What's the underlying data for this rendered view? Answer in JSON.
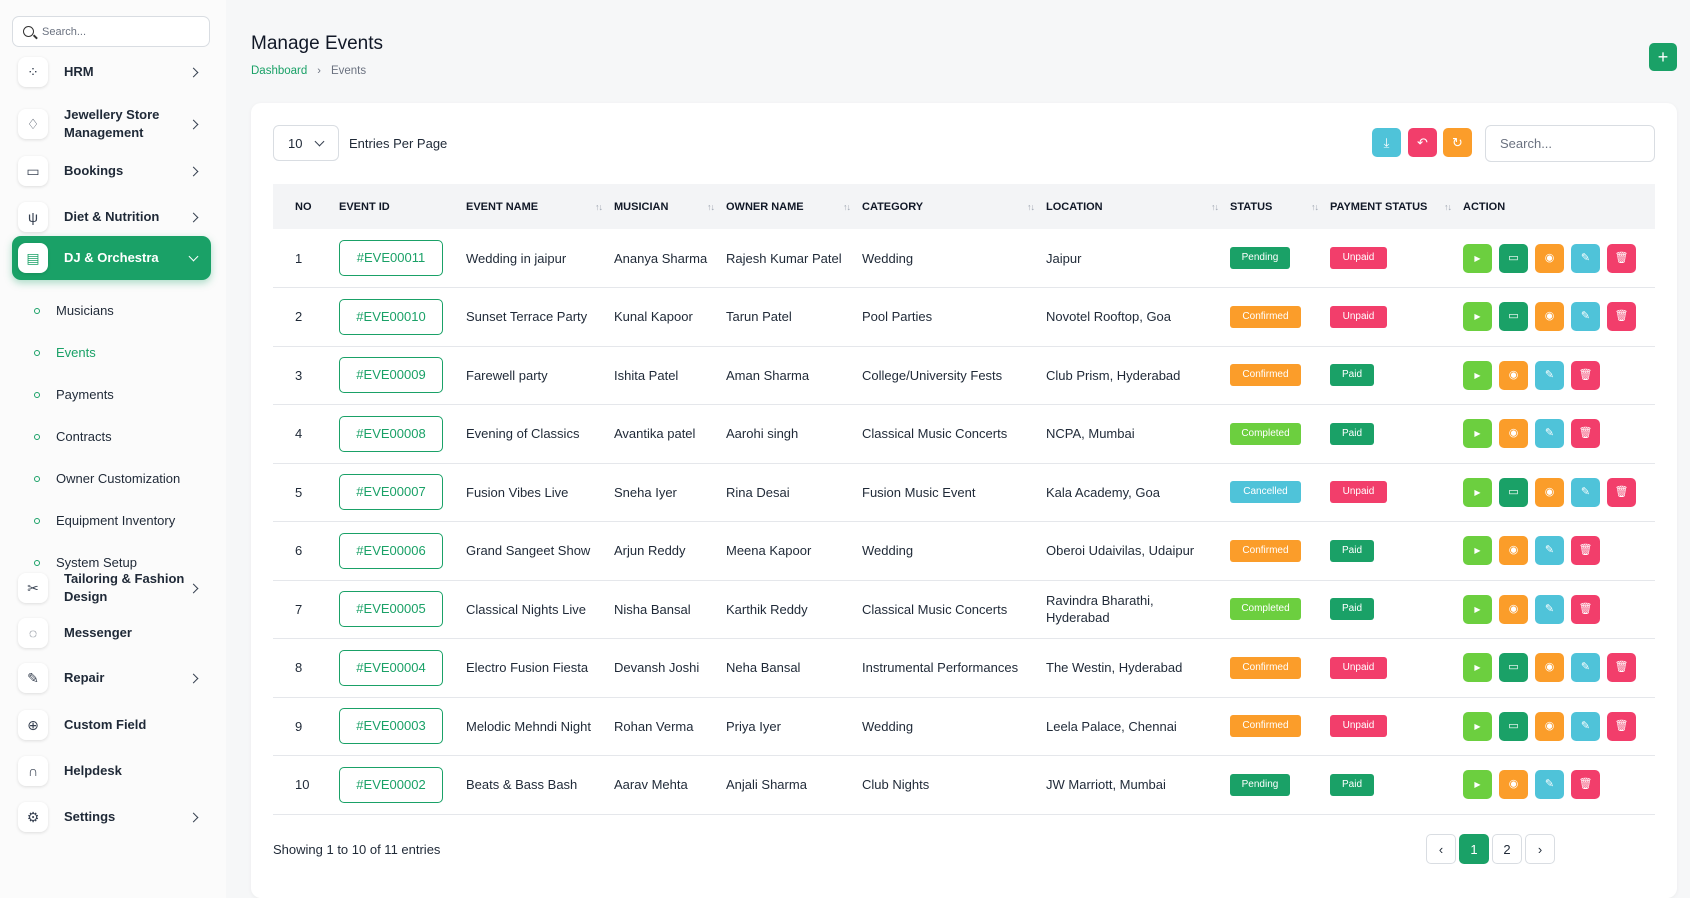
{
  "sidebar": {
    "search_placeholder": "Search...",
    "items": [
      {
        "label": "HRM",
        "icon": "hrm-icon",
        "glyph": "⁘"
      },
      {
        "label": "Jewellery Store Management",
        "icon": "diamond-icon",
        "glyph": "♢"
      },
      {
        "label": "Bookings",
        "icon": "book-icon",
        "glyph": "▭"
      },
      {
        "label": "Diet & Nutrition",
        "icon": "utensils-icon",
        "glyph": "ψ"
      },
      {
        "label": "DJ & Orchestra",
        "icon": "dj-icon",
        "glyph": "▤"
      },
      {
        "label": "Tailoring & Fashion Design",
        "icon": "scissors-icon",
        "glyph": "✂"
      },
      {
        "label": "Messenger",
        "icon": "chat-icon",
        "glyph": "◌"
      },
      {
        "label": "Repair",
        "icon": "wrench-icon",
        "glyph": "✎"
      },
      {
        "label": "Custom Field",
        "icon": "plus-circle-icon",
        "glyph": "⊕"
      },
      {
        "label": "Helpdesk",
        "icon": "headset-icon",
        "glyph": "∩"
      },
      {
        "label": "Settings",
        "icon": "gear-icon",
        "glyph": "⚙"
      }
    ],
    "sub_items": [
      "Musicians",
      "Events",
      "Payments",
      "Contracts",
      "Owner Customization",
      "Equipment Inventory",
      "System Setup"
    ]
  },
  "header": {
    "title": "Manage Events",
    "breadcrumb": [
      "Dashboard",
      "Events"
    ],
    "add_label": "+"
  },
  "toolbar": {
    "entries_value": "10",
    "entries_label": "Entries Per Page",
    "search_placeholder": "Search..."
  },
  "table": {
    "columns": [
      "NO",
      "EVENT ID",
      "EVENT NAME",
      "MUSICIAN",
      "OWNER NAME",
      "CATEGORY",
      "LOCATION",
      "STATUS",
      "PAYMENT STATUS",
      "ACTION"
    ],
    "rows": [
      {
        "no": "1",
        "id": "#EVE00011",
        "name": "Wedding in jaipur",
        "musician": "Ananya Sharma",
        "owner": "Rajesh Kumar Patel",
        "category": "Wedding",
        "location": "Jaipur",
        "status": "Pending",
        "payment": "Unpaid"
      },
      {
        "no": "2",
        "id": "#EVE00010",
        "name": "Sunset Terrace Party",
        "musician": "Kunal Kapoor",
        "owner": "Tarun Patel",
        "category": "Pool Parties",
        "location": "Novotel Rooftop, Goa",
        "status": "Confirmed",
        "payment": "Unpaid"
      },
      {
        "no": "3",
        "id": "#EVE00009",
        "name": "Farewell party",
        "musician": "Ishita Patel",
        "owner": "Aman Sharma",
        "category": "College/University Fests",
        "location": "Club Prism, Hyderabad",
        "status": "Confirmed",
        "payment": "Paid"
      },
      {
        "no": "4",
        "id": "#EVE00008",
        "name": "Evening of Classics",
        "musician": "Avantika patel",
        "owner": "Aarohi singh",
        "category": "Classical Music Concerts",
        "location": "NCPA, Mumbai",
        "status": "Completed",
        "payment": "Paid"
      },
      {
        "no": "5",
        "id": "#EVE00007",
        "name": "Fusion Vibes Live",
        "musician": "Sneha Iyer",
        "owner": "Rina Desai",
        "category": "Fusion Music Event",
        "location": "Kala Academy, Goa",
        "status": "Cancelled",
        "payment": "Unpaid"
      },
      {
        "no": "6",
        "id": "#EVE00006",
        "name": "Grand Sangeet Show",
        "musician": "Arjun Reddy",
        "owner": "Meena Kapoor",
        "category": "Wedding",
        "location": "Oberoi Udaivilas, Udaipur",
        "status": "Confirmed",
        "payment": "Paid"
      },
      {
        "no": "7",
        "id": "#EVE00005",
        "name": "Classical Nights Live",
        "musician": "Nisha Bansal",
        "owner": "Karthik Reddy",
        "category": "Classical Music Concerts",
        "location": "Ravindra Bharathi, Hyderabad",
        "status": "Completed",
        "payment": "Paid"
      },
      {
        "no": "8",
        "id": "#EVE00004",
        "name": "Electro Fusion Fiesta",
        "musician": "Devansh Joshi",
        "owner": "Neha Bansal",
        "category": "Instrumental Performances",
        "location": "The Westin, Hyderabad",
        "status": "Confirmed",
        "payment": "Unpaid"
      },
      {
        "no": "9",
        "id": "#EVE00003",
        "name": "Melodic Mehndi Night",
        "musician": "Rohan Verma",
        "owner": "Priya Iyer",
        "category": "Wedding",
        "location": "Leela Palace, Chennai",
        "status": "Confirmed",
        "payment": "Unpaid"
      },
      {
        "no": "10",
        "id": "#EVE00002",
        "name": "Beats & Bass Bash",
        "musician": "Aarav Mehta",
        "owner": "Anjali Sharma",
        "category": "Club Nights",
        "location": "JW Marriott, Mumbai",
        "status": "Pending",
        "payment": "Paid"
      }
    ]
  },
  "footer": {
    "showing": "Showing 1 to 10 of 11 entries",
    "pages": [
      "‹",
      "1",
      "2",
      "›"
    ],
    "active_page": "1"
  },
  "colors": {
    "brand": "#1aa167",
    "pending": "#1aa167",
    "confirmed": "#fb9d2a",
    "completed": "#6ccf3f",
    "cancelled": "#4fc3d9",
    "unpaid": "#f23e6b",
    "paid": "#1aa167"
  }
}
